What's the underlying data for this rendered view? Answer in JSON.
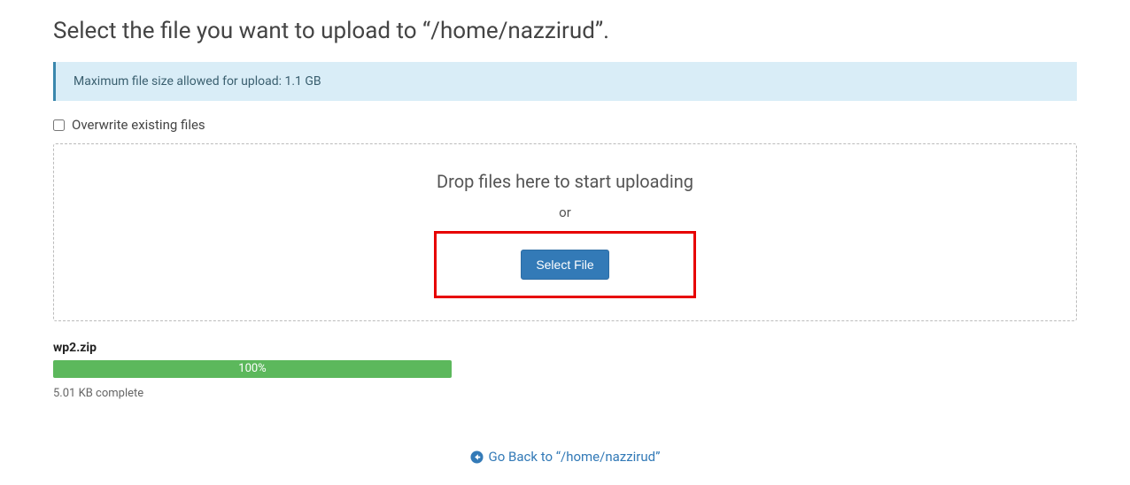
{
  "page": {
    "title": "Select the file you want to upload to “/home/nazzirud”."
  },
  "banner": {
    "text": "Maximum file size allowed for upload: 1.1 GB"
  },
  "overwrite": {
    "label": "Overwrite existing files",
    "checked": false
  },
  "dropzone": {
    "heading": "Drop files here to start uploading",
    "or": "or",
    "select_label": "Select File"
  },
  "upload": {
    "filename": "wp2.zip",
    "progress_text": "100%",
    "status": "5.01 KB complete"
  },
  "footer": {
    "go_back_label": "Go Back to “/home/nazzirud”"
  }
}
